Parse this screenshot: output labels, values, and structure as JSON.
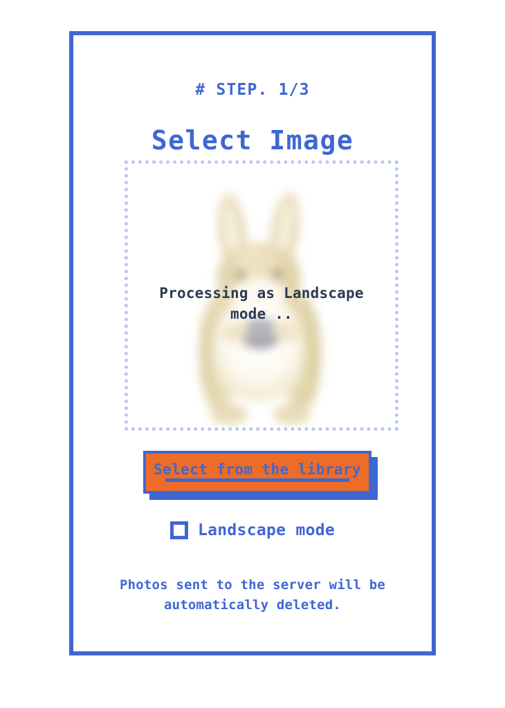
{
  "app": {
    "frame_border_color": "#3f67d2",
    "background_color": "#ffffff"
  },
  "header": {
    "step_label": "# STEP. 1/3",
    "title": "Select Image"
  },
  "preview": {
    "dotted_border_color": "#b9c7ee",
    "image_alt": "blurred-rabbit-photo",
    "image_colors": {
      "fur": "#e5d4ab",
      "fur_light": "#f3ead2",
      "belly": "#fbf8ef",
      "eye": "#7b6a55",
      "shadow": "#8e8e96"
    },
    "processing_text": "Processing as Landscape mode .."
  },
  "actions": {
    "select_library_label": "Select from the library",
    "button_fill_color": "#ec6c28",
    "button_border_color": "#3f67d2",
    "button_text_color": "#3f67d2"
  },
  "options": {
    "landscape_mode_label": "Landscape mode",
    "landscape_mode_checked": false
  },
  "footer": {
    "privacy_note": "Photos sent to the server will be automatically deleted."
  }
}
